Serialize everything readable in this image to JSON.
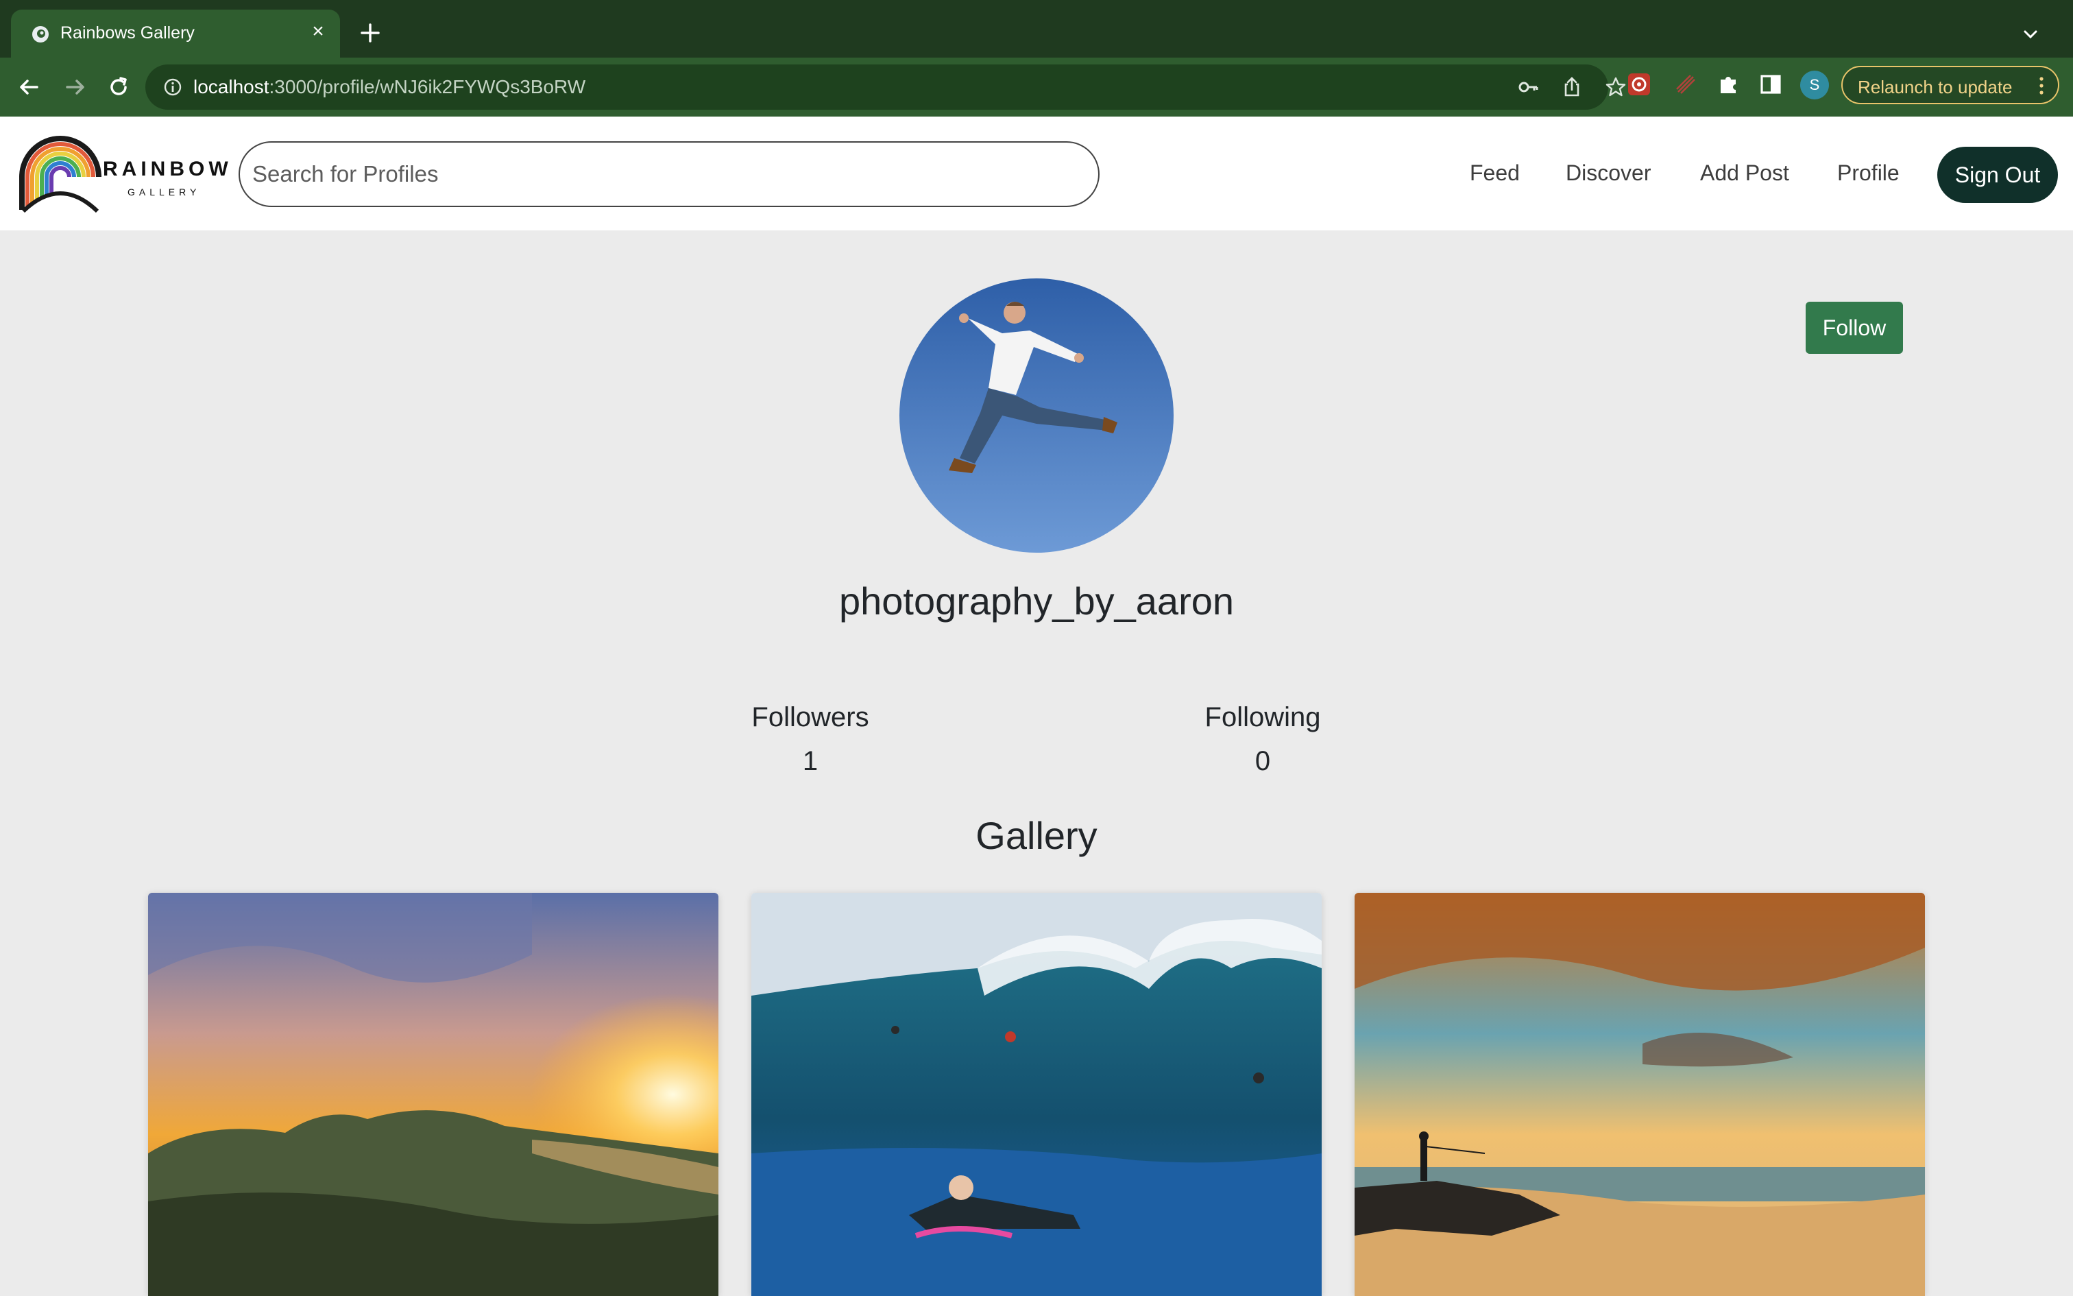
{
  "browser": {
    "tab_title": "Rainbows Gallery",
    "url_host": "localhost",
    "url_path": ":3000/profile/wNJ6ik2FYWQs3BoRW",
    "profile_initial": "S",
    "relaunch_label": "Relaunch to update",
    "icons": [
      "favicon-icon",
      "close-icon",
      "plus-icon",
      "chevron-down-icon",
      "back-icon",
      "forward-icon",
      "reload-icon",
      "info-icon",
      "key-icon",
      "share-icon",
      "star-icon",
      "extension-icon",
      "puzzle-icon",
      "sidebar-icon",
      "more-vert-icon"
    ]
  },
  "app": {
    "logo_word": "RAINBOW",
    "logo_sub": "GALLERY",
    "search_placeholder": "Search for Profiles",
    "nav": {
      "feed": "Feed",
      "discover": "Discover",
      "add_post": "Add Post",
      "profile": "Profile",
      "sign_out": "Sign Out"
    }
  },
  "profile": {
    "follow_label": "Follow",
    "username": "photography_by_aaron",
    "followers_label": "Followers",
    "followers_count": "1",
    "following_label": "Following",
    "following_count": "0",
    "gallery_heading": "Gallery",
    "gallery": [
      {
        "subject": "coastal sunset over green hills"
      },
      {
        "subject": "surfers riding a large wave"
      },
      {
        "subject": "fisherman on rocky beach at sunset"
      }
    ]
  },
  "colors": {
    "browser_frame": "#1f3a1f",
    "browser_toolbar": "#2f5d2f",
    "page_background": "#ebebeb",
    "sign_out_bg": "#10302a",
    "follow_bg": "#327a4c",
    "relaunch_accent": "#e9c46a"
  }
}
